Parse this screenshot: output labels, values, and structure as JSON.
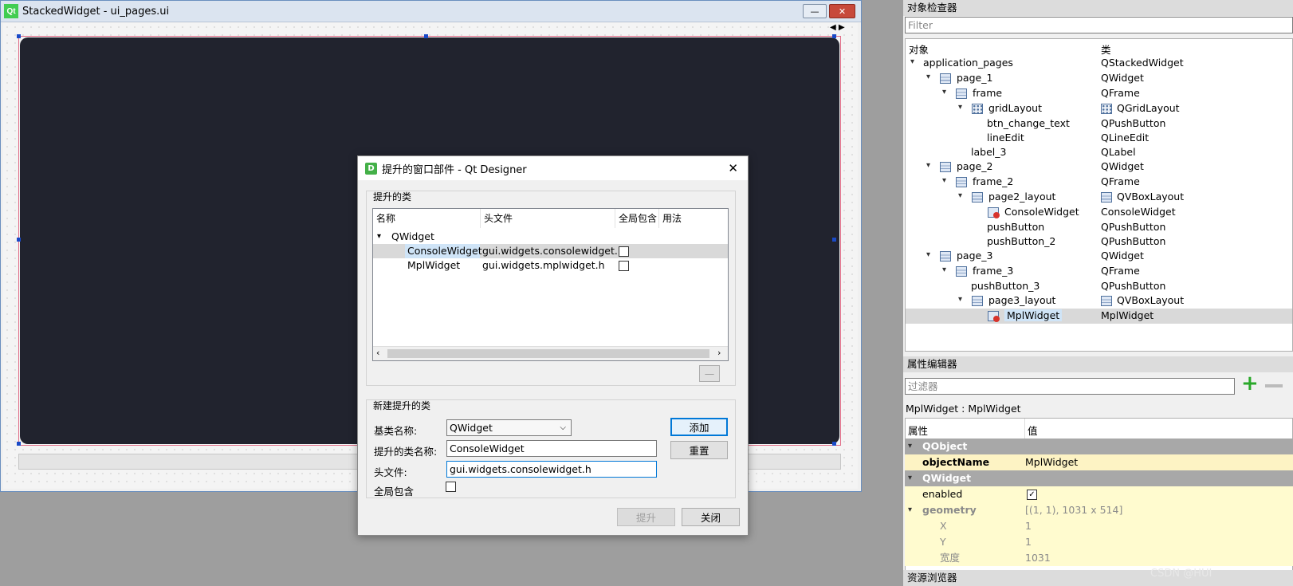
{
  "designer": {
    "title": "StackedWidget - ui_pages.ui",
    "logo": "Qt",
    "minimize": "—",
    "close": "✕"
  },
  "dialog": {
    "title": "提升的窗口部件 - Qt Designer",
    "icon": "D",
    "close": "✕",
    "promoted_group": "提升的类",
    "columns": [
      "名称",
      "头文件",
      "全局包含",
      "用法"
    ],
    "tree": {
      "parent": "QWidget",
      "children": [
        {
          "name": "ConsoleWidget",
          "header": "gui.widgets.consolewidget.h"
        },
        {
          "name": "MplWidget",
          "header": "gui.widgets.mplwidget.h"
        }
      ]
    },
    "remove_btn": "—",
    "new_group": "新建提升的类",
    "base_label": "基类名称:",
    "base_value": "QWidget",
    "class_label": "提升的类名称:",
    "class_value": "ConsoleWidget",
    "header_label": "头文件:",
    "header_value": "gui.widgets.consolewidget.h",
    "global_label": "全局包含",
    "add_btn": "添加",
    "reset_btn": "重置",
    "promote_btn": "提升",
    "close_btn": "关闭"
  },
  "inspector": {
    "title": "对象检查器",
    "filter_placeholder": "Filter",
    "col_object": "对象",
    "col_class": "类",
    "rows": [
      {
        "name": "application_pages",
        "cls": "QStackedWidget"
      },
      {
        "name": "page_1",
        "cls": "QWidget"
      },
      {
        "name": "frame",
        "cls": "QFrame"
      },
      {
        "name": "gridLayout",
        "cls": "QGridLayout"
      },
      {
        "name": "btn_change_text",
        "cls": "QPushButton"
      },
      {
        "name": "lineEdit",
        "cls": "QLineEdit"
      },
      {
        "name": "label_3",
        "cls": "QLabel"
      },
      {
        "name": "page_2",
        "cls": "QWidget"
      },
      {
        "name": "frame_2",
        "cls": "QFrame"
      },
      {
        "name": "page2_layout",
        "cls": "QVBoxLayout"
      },
      {
        "name": "ConsoleWidget",
        "cls": "ConsoleWidget"
      },
      {
        "name": "pushButton",
        "cls": "QPushButton"
      },
      {
        "name": "pushButton_2",
        "cls": "QPushButton"
      },
      {
        "name": "page_3",
        "cls": "QWidget"
      },
      {
        "name": "frame_3",
        "cls": "QFrame"
      },
      {
        "name": "pushButton_3",
        "cls": "QPushButton"
      },
      {
        "name": "page3_layout",
        "cls": "QVBoxLayout"
      },
      {
        "name": "MplWidget",
        "cls": "MplWidget"
      }
    ]
  },
  "property_editor": {
    "title": "属性编辑器",
    "filter_placeholder": "过滤器",
    "add_icon": "+",
    "object_label": "MplWidget : MplWidget",
    "col_prop": "属性",
    "col_value": "值",
    "sections": [
      "QObject",
      "QWidget"
    ],
    "props": [
      {
        "name": "objectName",
        "value": "MplWidget"
      },
      {
        "name": "enabled",
        "value": ""
      },
      {
        "name": "geometry",
        "value": "[(1, 1), 1031 x 514]"
      },
      {
        "name": "X",
        "value": "1"
      },
      {
        "name": "Y",
        "value": "1"
      },
      {
        "name": "宽度",
        "value": "1031"
      }
    ]
  },
  "resource_browser": {
    "title": "资源浏览器",
    "watermark": "CSDN @HUI"
  },
  "colors": {
    "canvas": "#21232e",
    "section_header": "#a8a8a8",
    "prop_bg": "#fffbcf",
    "selection": "#d9d9d9"
  }
}
